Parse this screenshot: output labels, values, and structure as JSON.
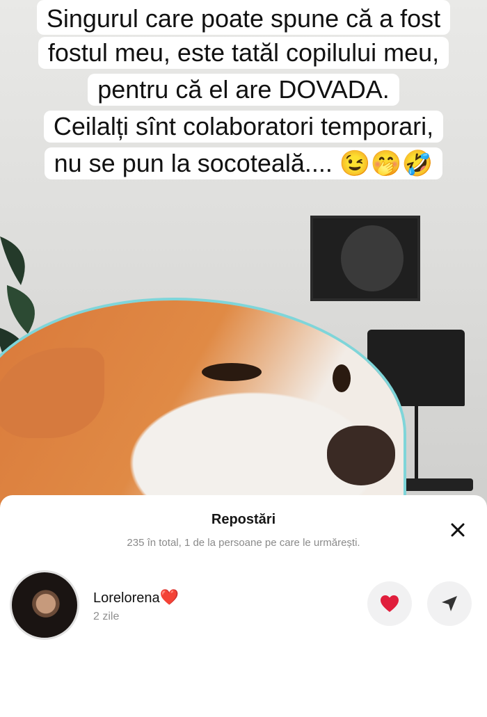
{
  "caption": {
    "lines": [
      "Singurul care poate spune că a fost",
      "fostul meu, este tatăl copilului meu,",
      "pentru că el are DOVADA.",
      "Ceilalți sînt colaboratori temporari,",
      "nu se pun la socoteală.... 😉🤭🤣"
    ]
  },
  "sheet": {
    "title": "Repostări",
    "subtitle": "235 în total, 1 de la persoane pe care le urmărești.",
    "close_icon": "close-icon"
  },
  "reposts": [
    {
      "username": "Lorelorena",
      "username_emoji": "❤️",
      "time": "2 zile",
      "like_icon": "heart-icon",
      "share_icon": "send-icon",
      "like_color": "#e01e3c"
    }
  ]
}
